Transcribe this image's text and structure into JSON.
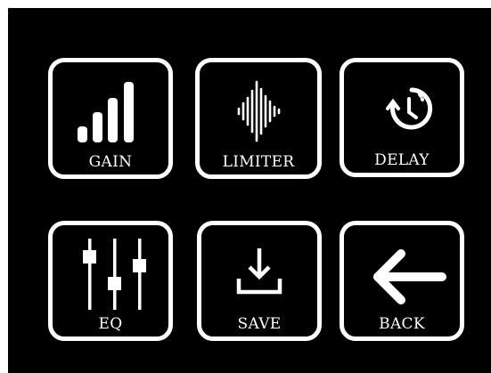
{
  "menu": {
    "tiles": [
      {
        "id": "gain",
        "label": "GAIN",
        "icon": "signal-bars-icon"
      },
      {
        "id": "limiter",
        "label": "LIMITER",
        "icon": "waveform-icon"
      },
      {
        "id": "delay",
        "label": "DELAY",
        "icon": "clock-timer-icon"
      },
      {
        "id": "eq",
        "label": "EQ",
        "icon": "equalizer-sliders-icon"
      },
      {
        "id": "save",
        "label": "SAVE",
        "icon": "download-icon"
      },
      {
        "id": "back",
        "label": "BACK",
        "icon": "arrow-left-icon"
      }
    ]
  },
  "colors": {
    "background": "#000000",
    "foreground": "#ffffff",
    "frame": "#ffffff"
  }
}
